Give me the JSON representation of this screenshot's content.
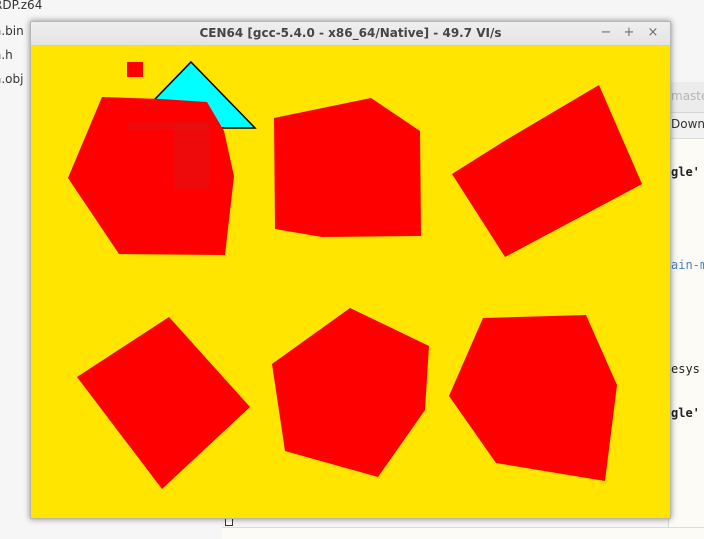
{
  "desktop": {
    "files": [
      {
        "name": "RDP.z64"
      },
      {
        "name": "a.bin"
      },
      {
        "name": "a.h"
      },
      {
        "name": "a.obj"
      }
    ]
  },
  "background_editor": {
    "title": "master",
    "toolbar_label": "Downlo",
    "code_lines": [
      {
        "text": "gle'",
        "style": "bold"
      },
      {
        "text": "ain-m",
        "style": "link"
      },
      {
        "text": "esys",
        "style": "plain"
      },
      {
        "text": "gle'",
        "style": "bold"
      }
    ]
  },
  "emulator_window": {
    "title": "CEN64 [gcc-5.4.0 - x86_64/Native] - 49.7 VI/s",
    "controls": {
      "minimize": "−",
      "maximize": "+",
      "close": "×"
    },
    "colors": {
      "background": "#ffe500",
      "shape_fill": "#ff0000",
      "triangle_fill": "#00ffff",
      "triangle_stroke": "#000000"
    }
  }
}
